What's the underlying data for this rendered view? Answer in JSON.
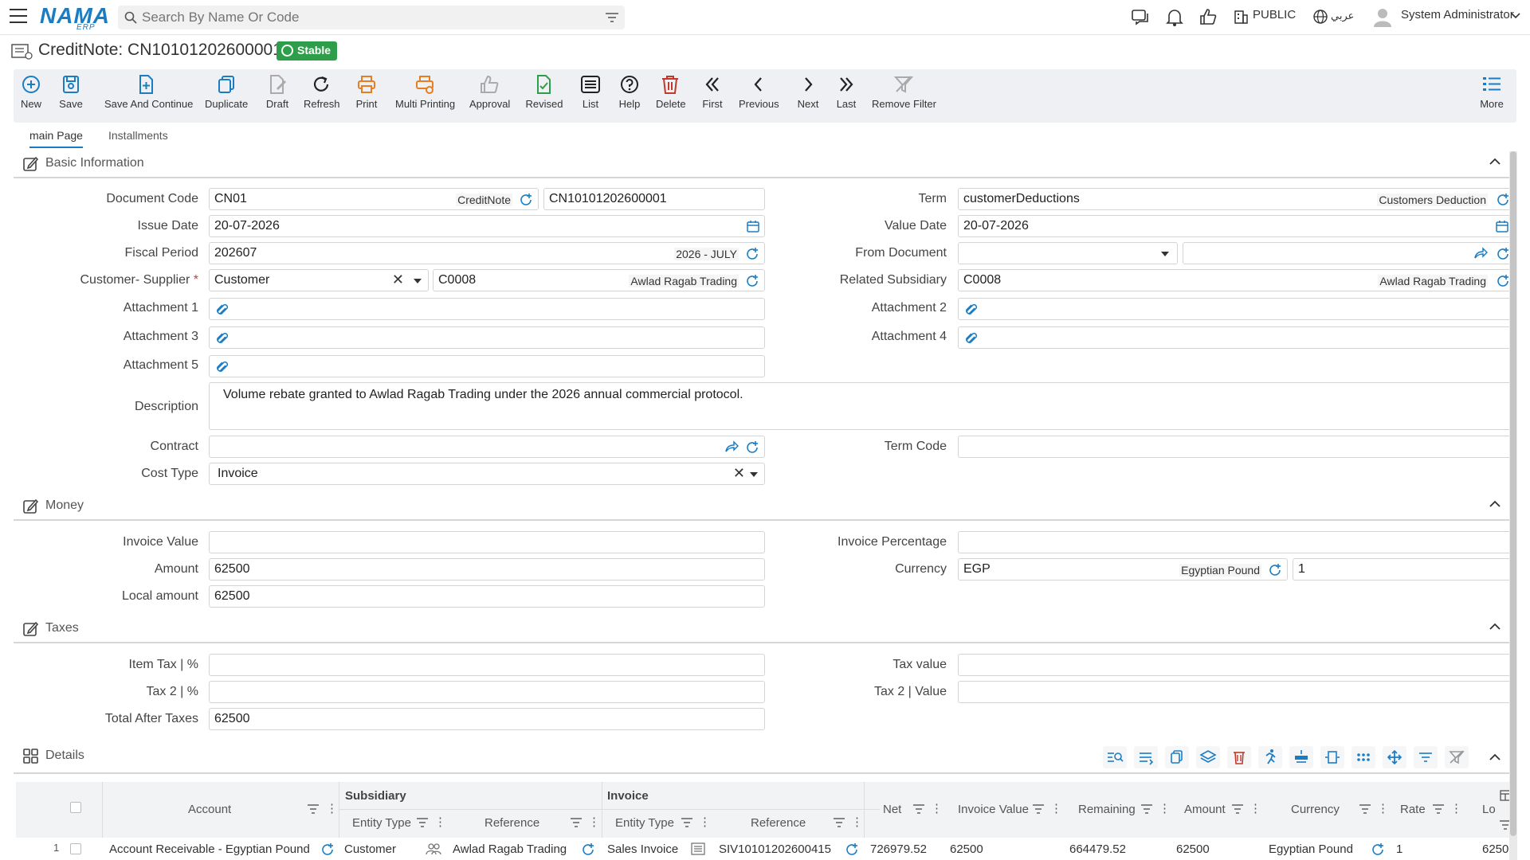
{
  "app": {
    "logo": "NAMA",
    "logo_sub": "ERP"
  },
  "search": {
    "placeholder": "Search By Name Or Code"
  },
  "topbar": {
    "public_label": "PUBLIC",
    "language_label": "عربي",
    "user_name": "System Administrator"
  },
  "title": {
    "text": "CreditNote: CN10101202600001",
    "status": "Stable"
  },
  "toolbar": {
    "new": "New",
    "save": "Save",
    "save_continue": "Save And Continue",
    "duplicate": "Duplicate",
    "draft": "Draft",
    "refresh": "Refresh",
    "print": "Print",
    "multi_printing": "Multi Printing",
    "approval": "Approval",
    "revised": "Revised",
    "list": "List",
    "help": "Help",
    "delete": "Delete",
    "first": "First",
    "previous": "Previous",
    "next": "Next",
    "last": "Last",
    "remove_filter": "Remove Filter",
    "more": "More"
  },
  "tabs": [
    "main Page",
    "Installments"
  ],
  "sections": {
    "basic": "Basic Information",
    "money": "Money",
    "taxes": "Taxes",
    "details": "Details"
  },
  "basic": {
    "document_code_label": "Document Code",
    "document_code": "CN01",
    "document_type": "CreditNote",
    "document_number": "CN10101202600001",
    "issue_date_label": "Issue Date",
    "issue_date": "20-07-2026",
    "fiscal_period_label": "Fiscal Period",
    "fiscal_period": "202607",
    "fiscal_period_name": "2026 - JULY",
    "customer_supplier_label": "Customer- Supplier",
    "required_mark": "*",
    "customer_type": "Customer",
    "customer_code": "C0008",
    "customer_name": "Awlad Ragab Trading",
    "attachment1_label": "Attachment 1",
    "attachment3_label": "Attachment 3",
    "attachment5_label": "Attachment 5",
    "attachment2_label": "Attachment 2",
    "attachment4_label": "Attachment 4",
    "description_label": "Description",
    "description": "Volume rebate granted to Awlad Ragab Trading under the 2026 annual commercial protocol.",
    "contract_label": "Contract",
    "cost_type_label": "Cost Type",
    "cost_type": "Invoice",
    "term_label": "Term",
    "term": "customerDeductions",
    "term_name": "Customers Deduction",
    "value_date_label": "Value Date",
    "value_date": "20-07-2026",
    "from_document_label": "From Document",
    "related_subsidiary_label": "Related Subsidiary",
    "related_subsidiary_code": "C0008",
    "related_subsidiary_name": "Awlad Ragab Trading",
    "term_code_label": "Term Code"
  },
  "money": {
    "invoice_value_label": "Invoice Value",
    "amount_label": "Amount",
    "amount": "62500",
    "local_amount_label": "Local amount",
    "local_amount": "62500",
    "invoice_percentage_label": "Invoice Percentage",
    "currency_label": "Currency",
    "currency_code": "EGP",
    "currency_name": "Egyptian Pound",
    "rate": "1"
  },
  "taxes": {
    "item_tax_label": "Item Tax | %",
    "tax2_label": "Tax 2 | %",
    "total_after_taxes_label": "Total After Taxes",
    "total_after_taxes": "62500",
    "tax_value_label": "Tax value",
    "tax2_value_label": "Tax 2 | Value"
  },
  "grid": {
    "group_subsidiary": "Subsidiary",
    "group_invoice": "Invoice",
    "headers": {
      "account": "Account",
      "entity_type": "Entity Type",
      "reference": "Reference",
      "inv_entity_type": "Entity Type",
      "inv_reference": "Reference",
      "net": "Net",
      "invoice_value": "Invoice Value",
      "remaining": "Remaining",
      "amount": "Amount",
      "currency": "Currency",
      "rate": "Rate",
      "local": "Lo"
    },
    "rows": [
      {
        "index": "1",
        "account": "Account Receivable - Egyptian Pound",
        "entity_type": "Customer",
        "reference": "Awlad Ragab Trading",
        "inv_entity_type": "Sales Invoice",
        "inv_reference": "SIV10101202600415",
        "net": "726979.52",
        "invoice_value": "62500",
        "remaining": "664479.52",
        "amount": "62500",
        "currency": "Egyptian Pound",
        "rate": "1",
        "local": "6250"
      }
    ]
  },
  "colors": {
    "accent": "#1a7dc4",
    "status_green": "#2f9e4a",
    "delete_red": "#c0392b",
    "print_orange": "#e67e22"
  }
}
